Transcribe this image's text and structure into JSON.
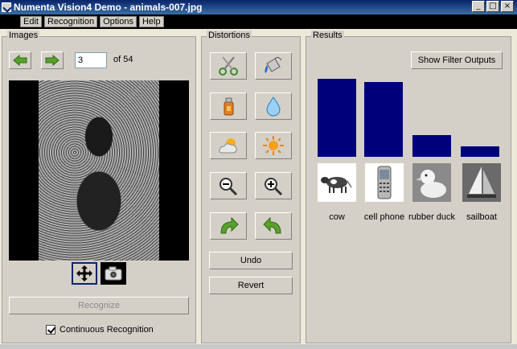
{
  "window": {
    "title": "Numenta Vision4 Demo - animals-007.jpg",
    "controls": [
      "_",
      "□",
      "×"
    ]
  },
  "menu": [
    "Edit",
    "Recognition",
    "Options",
    "Help"
  ],
  "images_panel": {
    "label": "Images",
    "page_value": "3",
    "page_total": "of 54",
    "recognize_label": "Recognize",
    "continuous_label": "Continuous Recognition",
    "continuous_checked": true
  },
  "distortions_panel": {
    "label": "Distortions",
    "tools": [
      {
        "icon": "scissors-icon"
      },
      {
        "icon": "paint-bucket-icon"
      },
      {
        "icon": "spray-can-icon"
      },
      {
        "icon": "water-drop-icon"
      },
      {
        "icon": "cloud-sun-icon"
      },
      {
        "icon": "sun-icon"
      },
      {
        "icon": "zoom-out-icon"
      },
      {
        "icon": "zoom-in-icon"
      },
      {
        "icon": "rotate-right-icon"
      },
      {
        "icon": "rotate-left-icon"
      }
    ],
    "undo_label": "Undo",
    "revert_label": "Revert"
  },
  "results_panel": {
    "label": "Results",
    "filter_button": "Show Filter Outputs"
  },
  "chart_data": {
    "type": "bar",
    "categories": [
      "cow",
      "cell phone",
      "rubber duck",
      "sailboat"
    ],
    "values": [
      0.97,
      0.93,
      0.27,
      0.13
    ],
    "ylim": [
      0,
      1
    ],
    "bar_color": "#00007b",
    "grid": false
  },
  "colors": {
    "accent": "#0a246a",
    "panel": "#d4d0c8",
    "bar": "#00007b"
  }
}
